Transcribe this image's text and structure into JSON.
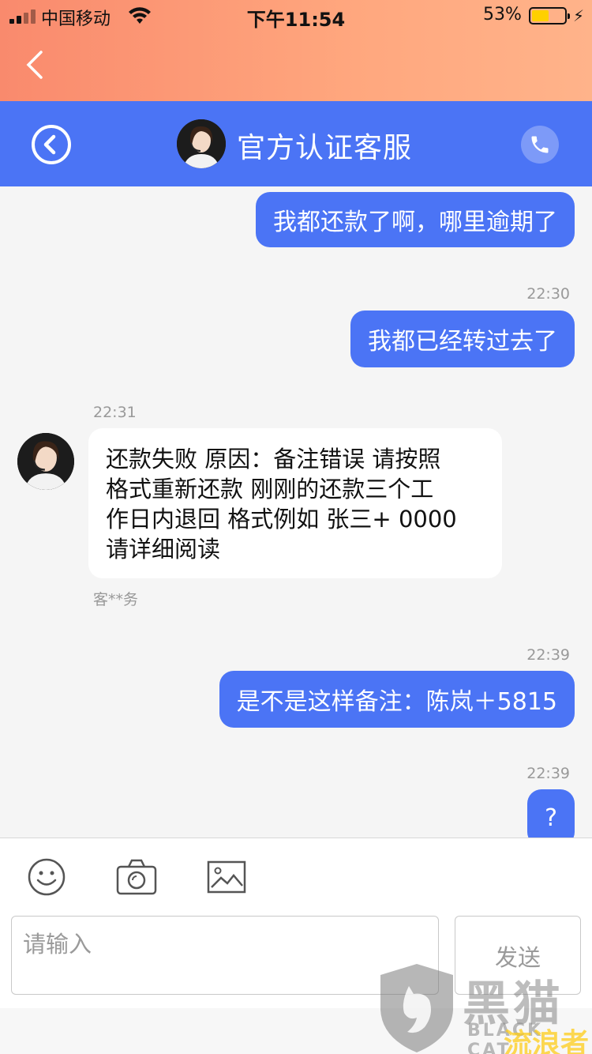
{
  "status_bar": {
    "carrier": "中国移动",
    "time": "下午11:54",
    "battery_percent": "53%",
    "battery_level": 0.53
  },
  "header": {
    "title": "官方认证客服"
  },
  "messages": [
    {
      "direction": "out",
      "text": "我都还款了啊，哪里逾期了"
    },
    {
      "direction": "out",
      "timestamp": "22:30",
      "text": "我都已经转过去了"
    },
    {
      "direction": "in",
      "timestamp": "22:31",
      "lines": [
        "还款失败 原因：备注错误 请按照",
        "格式重新还款 刚刚的还款三个工",
        "作日内退回 格式例如 张三+ 0000",
        "请详细阅读"
      ],
      "sender": "客**务"
    },
    {
      "direction": "out",
      "timestamp": "22:39",
      "text": "是不是这样备注：陈岚＋5815"
    },
    {
      "direction": "out",
      "timestamp": "22:39",
      "text": "?"
    }
  ],
  "composer": {
    "placeholder": "请输入",
    "send_label": "发送"
  },
  "icons": {
    "back": "chevron-left-icon",
    "header_back": "circle-back-icon",
    "call": "phone-icon",
    "emoji": "smiley-icon",
    "camera": "camera-icon",
    "image": "image-icon"
  },
  "colors": {
    "accent_blue": "#4b74f5",
    "top_gradient_start": "#f98a6d",
    "top_gradient_end": "#ffb38a"
  },
  "watermark": {
    "cn": "黑猫",
    "en": "BLACK CAT",
    "sub": "流浪者"
  }
}
